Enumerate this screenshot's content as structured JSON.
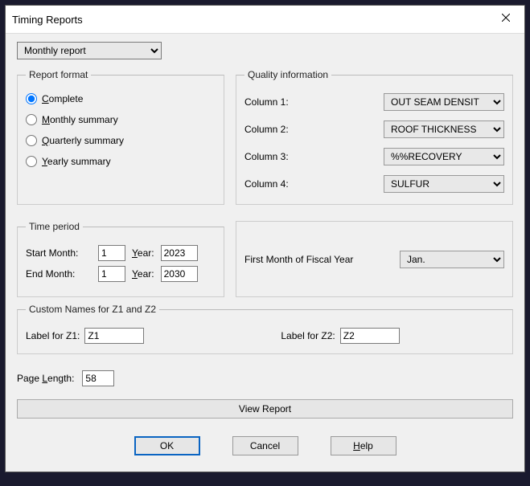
{
  "title": "Timing Reports",
  "top_select": "Monthly report",
  "report_format": {
    "legend": "Report format",
    "options": {
      "complete": "Complete",
      "monthly": "Monthly summary",
      "quarterly": "Quarterly summary",
      "yearly": "Yearly summary"
    },
    "selected": "complete"
  },
  "quality": {
    "legend": "Quality information",
    "col1_label": "Column 1:",
    "col1_value": "OUT SEAM DENSIT",
    "col2_label": "Column 2:",
    "col2_value": "ROOF THICKNESS",
    "col3_label": "Column 3:",
    "col3_value": "%%RECOVERY",
    "col4_label": "Column 4:",
    "col4_value": "SULFUR"
  },
  "time_period": {
    "legend": "Time period",
    "start_label": "Start Month:",
    "start_month": "1",
    "start_year_label": "Year:",
    "start_year": "2023",
    "end_label": "End Month:",
    "end_month": "1",
    "end_year_label": "Year:",
    "end_year": "2030"
  },
  "fiscal": {
    "label": "First Month of Fiscal Year",
    "value": "Jan."
  },
  "custom": {
    "legend": "Custom Names for Z1 and Z2",
    "z1_label": "Label for Z1:",
    "z1_value": "Z1",
    "z2_label": "Label for Z2:",
    "z2_value": "Z2"
  },
  "page_length": {
    "label": "Page Length:",
    "value": "58"
  },
  "buttons": {
    "view": "View Report",
    "ok": "OK",
    "cancel": "Cancel",
    "help": "Help"
  }
}
